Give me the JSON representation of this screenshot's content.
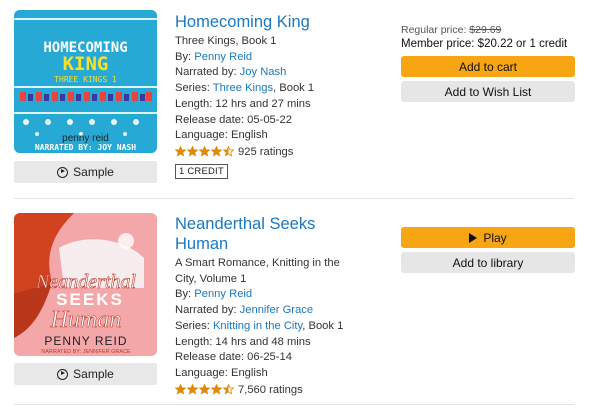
{
  "books": [
    {
      "title": "Homecoming King",
      "subtitle": "Three Kings, Book 1",
      "by_label": "By:",
      "author": "Penny Reid",
      "narrated_label": "Narrated by:",
      "narrator": "Joy Nash",
      "series_label": "Series:",
      "series_name": "Three Kings",
      "series_suffix": ", Book 1",
      "length": "Length: 12 hrs and 27 mins",
      "release": "Release date: 05-05-22",
      "language": "Language: English",
      "rating_stars": 4.5,
      "ratings_text": "925 ratings",
      "credit_badge": "1 CREDIT",
      "sample_label": "Sample",
      "cover": {
        "title_line1": "HOMECOMING",
        "title_line2": "KING",
        "series_line": "THREE KINGS 1",
        "author_line": "penny reid",
        "narrator_line": "NARRATED BY: JOY NASH"
      },
      "regular_price_label": "Regular price: ",
      "regular_price": "$29.69",
      "member_price": "Member price: $20.22 or 1 credit",
      "primary_button": "Add to cart",
      "secondary_button": "Add to Wish List"
    },
    {
      "title": "Neanderthal Seeks Human",
      "subtitle": "A Smart Romance, Knitting in the City, Volume 1",
      "by_label": "By:",
      "author": "Penny Reid",
      "narrated_label": "Narrated by:",
      "narrator": "Jennifer Grace",
      "series_label": "Series:",
      "series_name": "Knitting in the City",
      "series_suffix": ", Book 1",
      "length": "Length: 14 hrs and 48 mins",
      "release": "Release date: 06-25-14",
      "language": "Language: English",
      "rating_stars": 4.5,
      "ratings_text": "7,560 ratings",
      "sample_label": "Sample",
      "cover": {
        "title_line1": "Neanderthal",
        "title_line2": "SEEKS",
        "title_line3": "Human",
        "author_line": "PENNY REID",
        "narrator_line": "NARRATED BY: JENNIFER GRACE"
      },
      "primary_button": "Play",
      "secondary_button": "Add to library"
    }
  ],
  "colors": {
    "link": "#1a78c2",
    "accent_button": "#f7a513",
    "star": "#e08a0b"
  }
}
